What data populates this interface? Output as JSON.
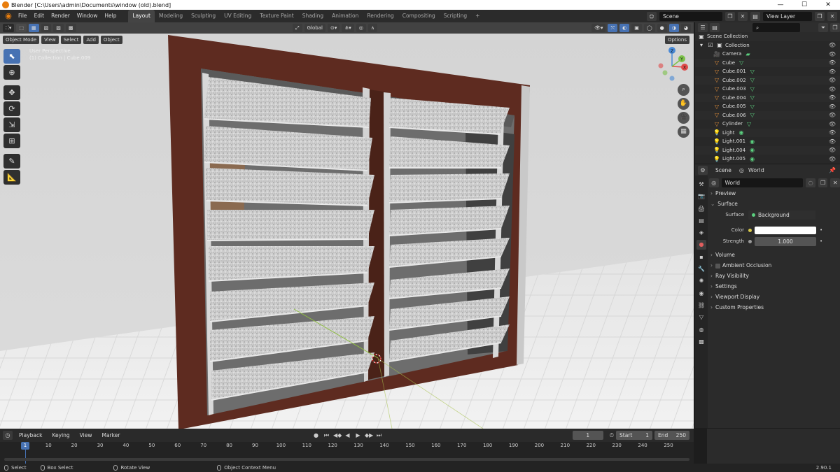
{
  "window": {
    "title": "Blender [C:\\Users\\admin\\Documents\\window (old).blend]",
    "controls": [
      "—",
      "☐",
      "✕"
    ]
  },
  "menu": [
    "File",
    "Edit",
    "Render",
    "Window",
    "Help"
  ],
  "workspaces": [
    "Layout",
    "Modeling",
    "Sculpting",
    "UV Editing",
    "Texture Paint",
    "Shading",
    "Animation",
    "Rendering",
    "Compositing",
    "Scripting"
  ],
  "scene_field": "Scene",
  "view_layer_field": "View Layer",
  "viewport": {
    "mode": "Object Mode",
    "menus": [
      "View",
      "Select",
      "Add",
      "Object"
    ],
    "transform_orientation": "Global",
    "options_label": "Options",
    "perspective_label": "User Perspective",
    "object_info": "(1) Collection | Cube.009",
    "gizmo_axes": {
      "x": "X",
      "y": "Y",
      "z": "Z"
    }
  },
  "outliner": {
    "root": "Scene Collection",
    "collection": "Collection",
    "items": [
      {
        "name": "Camera",
        "kind": "camera"
      },
      {
        "name": "Cube",
        "kind": "mesh"
      },
      {
        "name": "Cube.001",
        "kind": "mesh"
      },
      {
        "name": "Cube.002",
        "kind": "mesh"
      },
      {
        "name": "Cube.003",
        "kind": "mesh"
      },
      {
        "name": "Cube.004",
        "kind": "mesh"
      },
      {
        "name": "Cube.005",
        "kind": "mesh"
      },
      {
        "name": "Cube.006",
        "kind": "mesh"
      },
      {
        "name": "Cylinder",
        "kind": "mesh"
      },
      {
        "name": "Light",
        "kind": "light"
      },
      {
        "name": "Light.001",
        "kind": "light"
      },
      {
        "name": "Light.004",
        "kind": "light"
      },
      {
        "name": "Light.005",
        "kind": "light"
      }
    ]
  },
  "properties": {
    "breadcrumb_scene": "Scene",
    "breadcrumb_world": "World",
    "world_name": "World",
    "panels": {
      "preview": "Preview",
      "surface": "Surface",
      "volume": "Volume",
      "ambient_occlusion": "Ambient Occlusion",
      "ray_visibility": "Ray Visibility",
      "settings": "Settings",
      "viewport_display": "Viewport Display",
      "custom_properties": "Custom Properties"
    },
    "surface_label": "Surface",
    "surface_value": "Background",
    "color_label": "Color",
    "color_value": "#ffffff",
    "strength_label": "Strength",
    "strength_value": "1.000"
  },
  "timeline": {
    "menus": [
      "Playback",
      "Keying",
      "View",
      "Marker"
    ],
    "current_frame": "1",
    "start_label": "Start",
    "start_value": "1",
    "end_label": "End",
    "end_value": "250",
    "ruler": [
      "1",
      "10",
      "20",
      "30",
      "40",
      "50",
      "60",
      "70",
      "80",
      "90",
      "100",
      "110",
      "120",
      "130",
      "140",
      "150",
      "160",
      "170",
      "180",
      "190",
      "200",
      "210",
      "220",
      "230",
      "240",
      "250"
    ]
  },
  "status": {
    "select": "Select",
    "box_select": "Box Select",
    "rotate_view": "Rotate View",
    "context_menu": "Object Context Menu",
    "version": "2.90.1"
  },
  "colors": {
    "accent": "#4772b3",
    "frame_wood": "#5a2a1f",
    "glass_frosted": "#d8d8d8",
    "floor": "#e9e9e9",
    "background": "#3d3d3d"
  }
}
